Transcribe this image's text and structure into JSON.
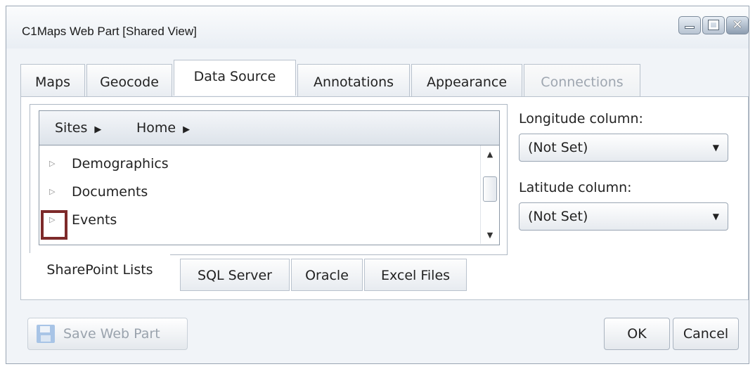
{
  "window": {
    "title": "C1Maps Web Part [Shared View]",
    "minimize_icon": "minimize-icon",
    "maximize_icon": "maximize-icon",
    "close_icon": "close-icon",
    "close_glyph": "✕"
  },
  "tabs": [
    {
      "label": "Maps",
      "state": "normal"
    },
    {
      "label": "Geocode",
      "state": "normal"
    },
    {
      "label": "Data Source",
      "state": "active"
    },
    {
      "label": "Annotations",
      "state": "normal"
    },
    {
      "label": "Appearance",
      "state": "normal"
    },
    {
      "label": "Connections",
      "state": "disabled"
    }
  ],
  "breadcrumb": [
    {
      "label": "Sites",
      "arrow": "▶"
    },
    {
      "label": "Home",
      "arrow": "▶"
    }
  ],
  "list": {
    "items": [
      {
        "label": "Demographics",
        "expand": "▷"
      },
      {
        "label": "Documents",
        "expand": "▷"
      },
      {
        "label": "Events",
        "expand": "▷"
      }
    ],
    "scroll_up": "▲",
    "scroll_down": "▼"
  },
  "source_tabs": [
    {
      "label": "SharePoint Lists",
      "state": "active"
    },
    {
      "label": "SQL Server",
      "state": "normal"
    },
    {
      "label": "Oracle",
      "state": "normal"
    },
    {
      "label": "Excel Files",
      "state": "normal"
    }
  ],
  "longitude": {
    "label": "Longitude column:",
    "value": "(Not Set)",
    "caret": "▼"
  },
  "latitude": {
    "label": "Latitude column:",
    "value": "(Not Set)",
    "caret": "▼"
  },
  "footer": {
    "save_label": "Save Web Part",
    "save_icon": "save-icon",
    "ok_label": "OK",
    "cancel_label": "Cancel"
  },
  "colors": {
    "highlight": "#7d2a2a",
    "disabled_text": "#9ea6b0",
    "border": "#9aa6b4"
  }
}
